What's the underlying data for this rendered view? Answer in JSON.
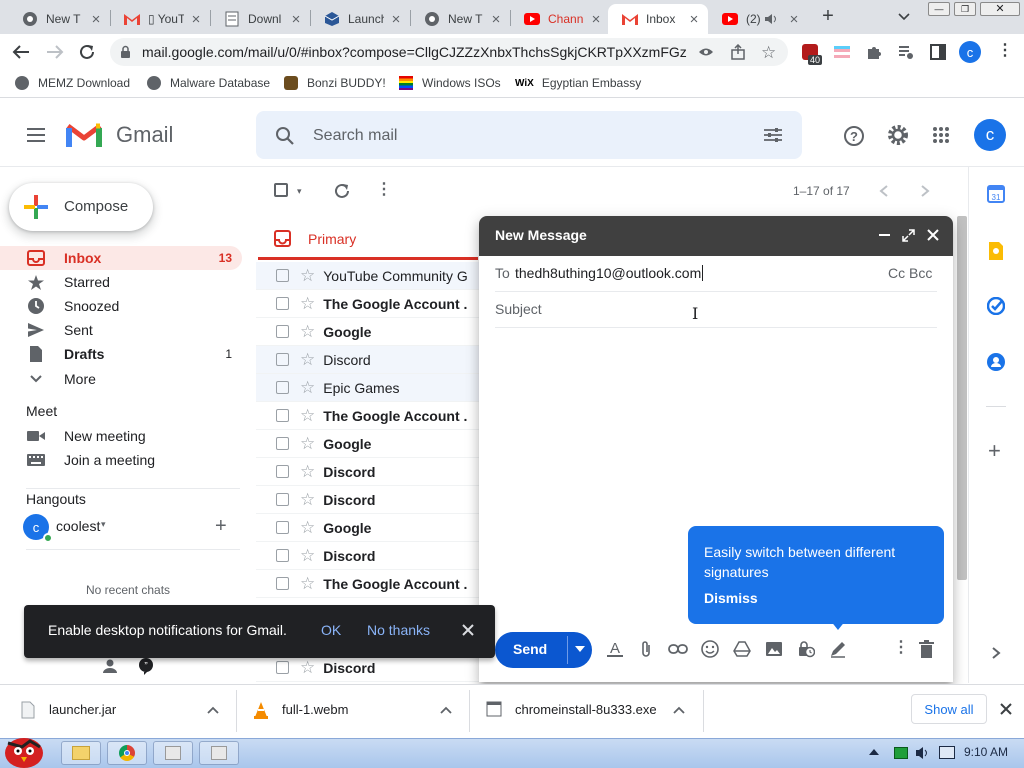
{
  "browser": {
    "tabs": [
      {
        "title": "New T",
        "icon": "chrome-icon",
        "active": false
      },
      {
        "title": "▯ YouT",
        "icon": "gmail-icon",
        "active": false
      },
      {
        "title": "Downl",
        "icon": "document-icon",
        "active": false
      },
      {
        "title": "Launch",
        "icon": "cube-icon",
        "active": false
      },
      {
        "title": "New T",
        "icon": "chrome-icon",
        "active": false
      },
      {
        "title": "Chann",
        "icon": "youtube-icon",
        "active": false
      },
      {
        "title": "Inbox",
        "icon": "gmail-icon",
        "active": true
      },
      {
        "title": "(2)",
        "icon": "youtube-icon",
        "active": false
      }
    ],
    "url": "mail.google.com/mail/u/0/#inbox?compose=CllgCJZZzXnbxThchsSgkjCKRTpXXzmFGz...",
    "extension_badge": "40",
    "profile_initial": "c",
    "bookmarks": [
      "MEMZ Download",
      "Malware Database",
      "Bonzi BUDDY!",
      "Windows ISOs",
      "Egyptian Embassy"
    ]
  },
  "gmail": {
    "logo_text": "Gmail",
    "search_placeholder": "Search mail",
    "account_initial": "c",
    "compose_label": "Compose",
    "nav": [
      {
        "label": "Inbox",
        "count": "13"
      },
      {
        "label": "Starred",
        "count": ""
      },
      {
        "label": "Snoozed",
        "count": ""
      },
      {
        "label": "Sent",
        "count": ""
      },
      {
        "label": "Drafts",
        "count": "1"
      },
      {
        "label": "More",
        "count": ""
      }
    ],
    "meet": {
      "heading": "Meet",
      "new_meeting": "New meeting",
      "join": "Join a meeting"
    },
    "hangouts": {
      "heading": "Hangouts",
      "user_initial": "c",
      "user": "coolest",
      "no_chats": "No recent chats"
    },
    "pagination": "1–17 of 17",
    "primary_tab": "Primary",
    "emails": [
      {
        "sender": "YouTube Community G",
        "unread": false
      },
      {
        "sender": "The Google Account .",
        "unread": true
      },
      {
        "sender": "Google",
        "unread": true
      },
      {
        "sender": "Discord",
        "unread": false
      },
      {
        "sender": "Epic Games",
        "unread": false
      },
      {
        "sender": "The Google Account .",
        "unread": true
      },
      {
        "sender": "Google",
        "unread": true
      },
      {
        "sender": "Discord",
        "unread": true
      },
      {
        "sender": "Discord",
        "unread": true
      },
      {
        "sender": "Google",
        "unread": true
      },
      {
        "sender": "Discord",
        "unread": true
      },
      {
        "sender": "The Google Account .",
        "unread": true
      },
      {
        "sender": "Discord",
        "unread": true
      }
    ]
  },
  "compose": {
    "title": "New Message",
    "to_label": "To",
    "to_value": "thedh8uthing10@outlook.com",
    "cc_bcc": "Cc Bcc",
    "subject_placeholder": "Subject",
    "send_label": "Send",
    "tooltip": {
      "text": "Easily switch between different signatures",
      "action": "Dismiss"
    }
  },
  "notification": {
    "text": "Enable desktop notifications for Gmail.",
    "ok": "OK",
    "no_thanks": "No thanks"
  },
  "downloads": {
    "items": [
      "launcher.jar",
      "full-1.webm",
      "chromeinstall-8u333.exe"
    ],
    "show_all": "Show all"
  },
  "taskbar": {
    "time": "9:10 AM"
  },
  "colors": {
    "gmail_red": "#d93025",
    "accent_blue": "#0b57d0",
    "compose_header": "#404040",
    "tooltip_blue": "#1a73e8"
  }
}
